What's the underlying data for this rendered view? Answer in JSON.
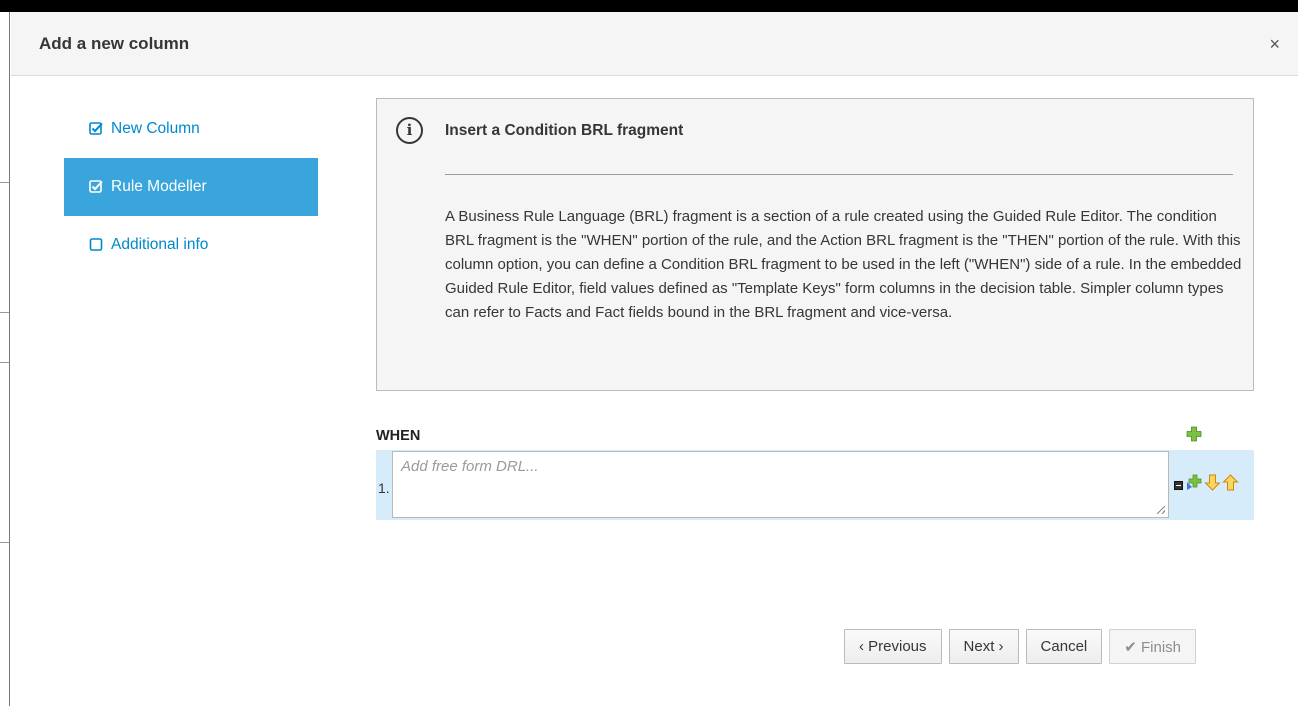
{
  "modal": {
    "title": "Add a new column",
    "close_glyph": "×"
  },
  "steps": [
    {
      "label": "New Column",
      "checked": true,
      "active": false,
      "icon": "checked-box-icon"
    },
    {
      "label": "Rule Modeller",
      "checked": true,
      "active": true,
      "icon": "checked-box-icon"
    },
    {
      "label": "Additional info",
      "checked": false,
      "active": false,
      "icon": "empty-box-icon"
    }
  ],
  "info": {
    "icon": "info-circle-icon",
    "title": "Insert a Condition BRL fragment",
    "body": "A Business Rule Language (BRL) fragment is a section of a rule created using the Guided Rule Editor. The condition BRL fragment is the \"WHEN\" portion of the rule, and the Action BRL fragment is the \"THEN\" portion of the rule. With this column option, you can define a Condition BRL fragment to be used in the left (\"WHEN\") side of a rule. In the embedded Guided Rule Editor, field values defined as \"Template Keys\" form columns in the decision table. Simpler column types can refer to Facts and Fact fields bound in the BRL fragment and vice-versa."
  },
  "when": {
    "label": "WHEN",
    "rows": [
      {
        "number": "1.",
        "value": "",
        "placeholder": "Add free form DRL..."
      }
    ]
  },
  "buttons": {
    "previous": "‹ Previous",
    "next": "Next ›",
    "cancel": "Cancel",
    "finish": "✔ Finish"
  },
  "colors": {
    "active_step_bg": "#39a5dc",
    "link": "#0088ce",
    "when_row_bg": "#d7ecfb"
  }
}
